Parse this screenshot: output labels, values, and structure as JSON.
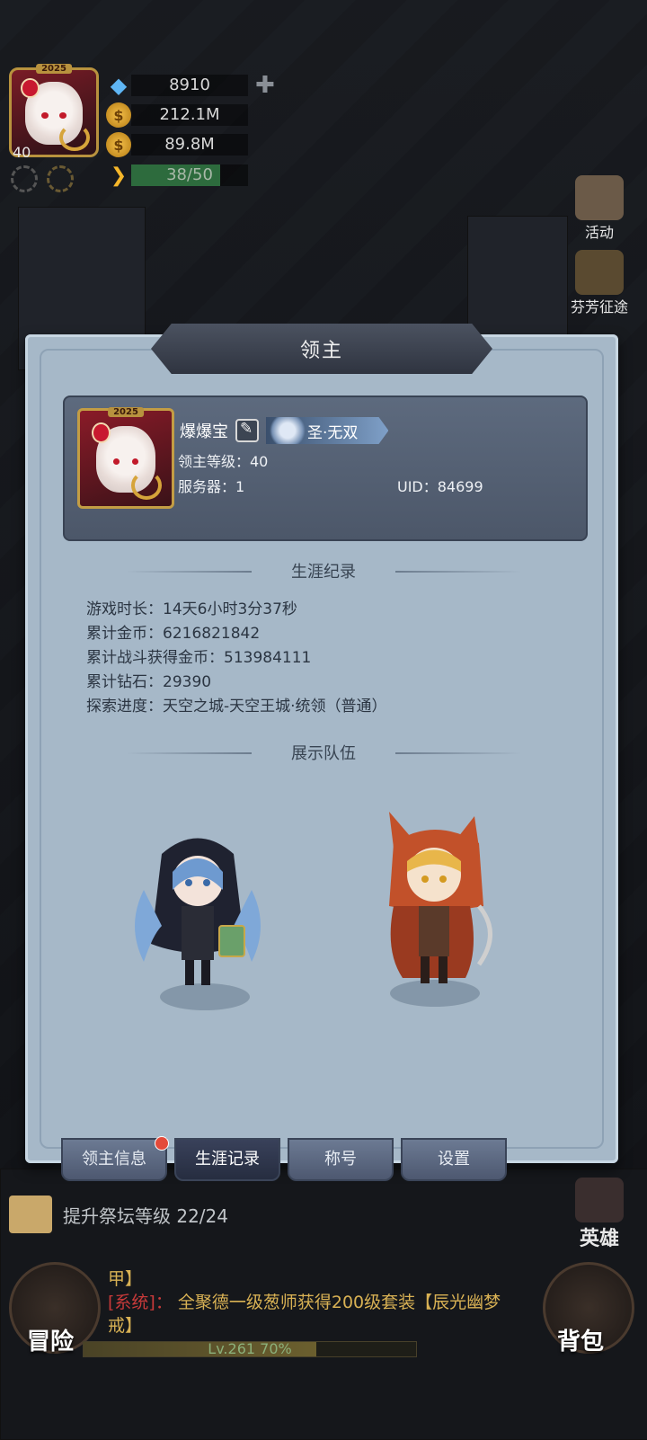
{
  "hud": {
    "avatar_year": "2025",
    "level": "40",
    "diamonds": "8910",
    "gold": "212.1M",
    "silver": "89.8M",
    "energy": "38/50",
    "energy_fraction": 0.76
  },
  "side_menu": {
    "activity": "活动",
    "trial": "芬芳征途",
    "hero": "英雄",
    "bag": "背包",
    "adventure": "冒险"
  },
  "modal": {
    "title": "领主",
    "profile": {
      "name": "爆爆宝",
      "title_badge": "圣·无双",
      "year_tag": "2025",
      "level_line": "领主等级：40",
      "server_line": "服务器：1",
      "uid_line": "UID：84699"
    },
    "career_header": "生涯纪录",
    "stats": [
      "游戏时长：14天6小时3分37秒",
      "累计金币：6216821842",
      "累计战斗获得金币：513984111",
      "累计钻石：29390",
      "探索进度：天空之城-天空王城·统领（普通）"
    ],
    "team_header": "展示队伍"
  },
  "tabs": [
    "领主信息",
    "生涯记录",
    "称号",
    "设置"
  ],
  "quest": "提升祭坛等级 22/24",
  "chat": {
    "line0": "甲】",
    "tag": "[系统]：",
    "message": "全聚德一级葱师获得200级套装【辰光幽梦戒】"
  },
  "xp": {
    "label": "Lv.261  70%",
    "fraction": 0.7
  }
}
